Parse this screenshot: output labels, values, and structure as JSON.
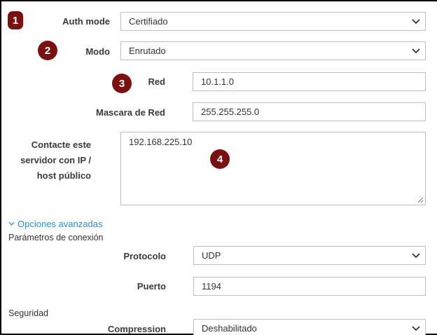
{
  "badges": {
    "b1": "1",
    "b2": "2",
    "b3": "3",
    "b4": "4"
  },
  "fields": {
    "auth_mode": {
      "label": "Auth mode",
      "value": "Certifiado"
    },
    "modo": {
      "label": "Modo",
      "value": "Enrutado"
    },
    "red": {
      "label": "Red",
      "value": "10.1.1.0"
    },
    "mascara": {
      "label": "Mascara de Red",
      "value": "255.255.255.0"
    },
    "contacte": {
      "label_line1": "Contacte este",
      "label_line2": "servidor con IP /",
      "label_line3": "host público",
      "value": "192.168.225.10"
    }
  },
  "advanced": {
    "toggle_label": "Opciones avanzadas",
    "conexion_heading": "Parámetros de conexión",
    "protocolo": {
      "label": "Protocolo",
      "value": "UDP"
    },
    "puerto": {
      "label": "Puerto",
      "value": "1194"
    },
    "seguridad_heading": "Seguridad",
    "compression": {
      "label": "Compression",
      "value": "Deshabilitado"
    }
  },
  "colors": {
    "badge": "#7a1010",
    "link": "#2a8fd6",
    "border": "#bfbfbf"
  },
  "icons": {
    "select_arrow": "chevron-down-icon",
    "resize": "resize-grip-icon",
    "toggle": "chevron-down-icon"
  }
}
